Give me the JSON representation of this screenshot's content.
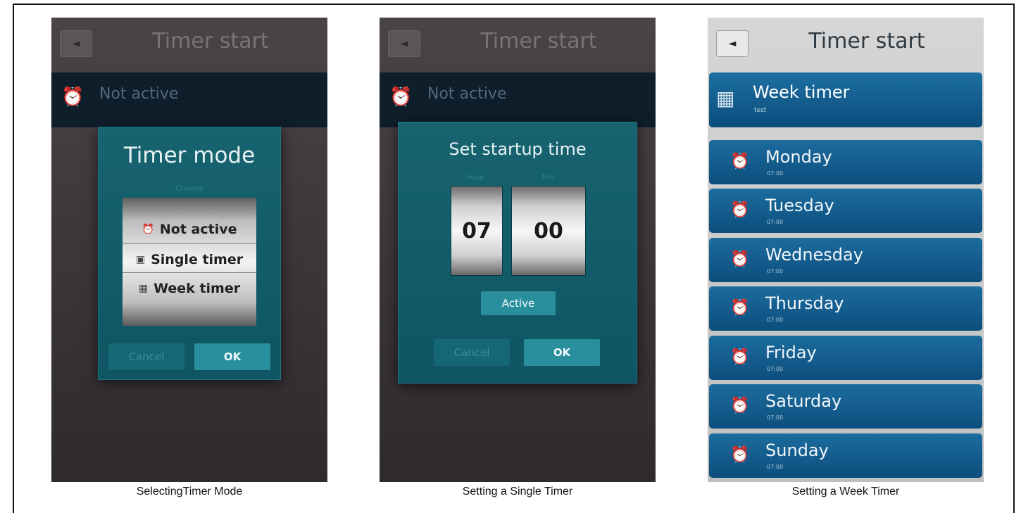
{
  "panel1": {
    "header_title": "Timer start",
    "status_text": "Not active",
    "dialog_title": "Timer mode",
    "dialog_subtitle": "Choose",
    "options": [
      "Not active",
      "Single timer",
      "Week timer"
    ],
    "selected_option": "Single timer",
    "cancel_label": "Cancel",
    "ok_label": "OK",
    "caption": "SelectingTimer Mode"
  },
  "panel2": {
    "header_title": "Timer start",
    "status_text": "Not active",
    "dialog_title": "Set startup time",
    "hour_label": "Hour",
    "minute_label": "Min",
    "hour_value": "07",
    "minute_value": "00",
    "active_label": "Active",
    "cancel_label": "Cancel",
    "ok_label": "OK",
    "caption": "Setting a Single Timer"
  },
  "panel3": {
    "header_title": "Timer start",
    "mode_title": "Week timer",
    "mode_subtitle": "test",
    "days": [
      {
        "name": "Monday",
        "time": "07:00"
      },
      {
        "name": "Tuesday",
        "time": "07:00"
      },
      {
        "name": "Wednesday",
        "time": "07:00"
      },
      {
        "name": "Thursday",
        "time": "07:00"
      },
      {
        "name": "Friday",
        "time": "07:00"
      },
      {
        "name": "Saturday",
        "time": "07:00"
      },
      {
        "name": "Sunday",
        "time": "07:00"
      }
    ],
    "caption": "Setting a Week Timer"
  },
  "icons": {
    "back": "back-arrow-icon",
    "timer_off": "alarm-off-icon",
    "single_timer": "single-timer-icon",
    "week_timer": "week-timer-icon",
    "alarm": "alarm-clock-icon"
  },
  "colors": {
    "dialog": "#17636f",
    "ok_button": "#2a8f9c",
    "day_button": "#0c4e7d"
  }
}
